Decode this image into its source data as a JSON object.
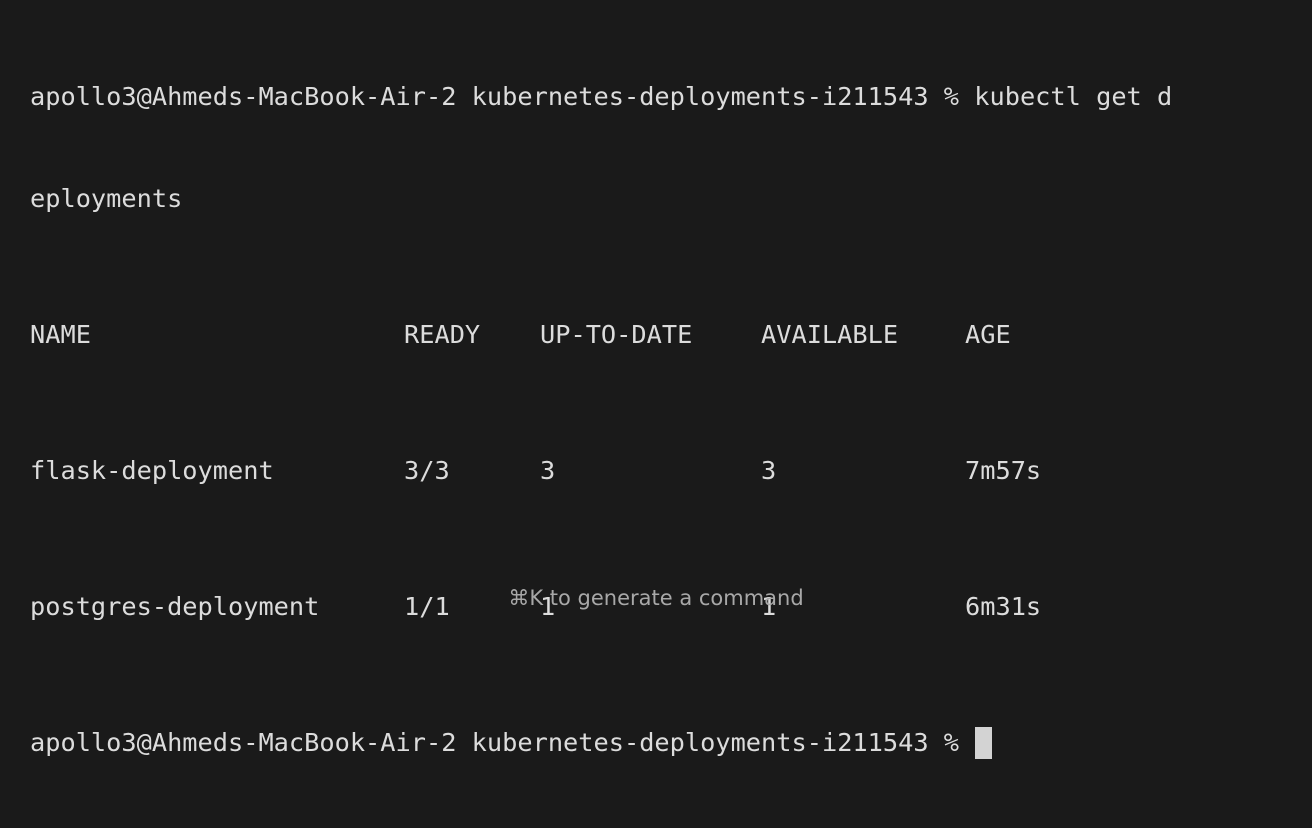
{
  "terminal": {
    "command_line_1": "apollo3@Ahmeds-MacBook-Air-2 kubernetes-deployments-i211543 % kubectl get d",
    "command_line_2": "eployments",
    "table": {
      "headers": [
        "NAME",
        "READY",
        "UP-TO-DATE",
        "AVAILABLE",
        "AGE"
      ],
      "rows": [
        [
          "flask-deployment",
          "3/3",
          "3",
          "3",
          "7m57s"
        ],
        [
          "postgres-deployment",
          "1/1",
          "1",
          "1",
          "6m31s"
        ]
      ]
    },
    "prompt": "apollo3@Ahmeds-MacBook-Air-2 kubernetes-deployments-i211543 %"
  },
  "hint": {
    "text": "⌘K to generate a command"
  },
  "colors": {
    "background": "#1a1a1a",
    "text": "#dcdcdc",
    "cursor": "#d3d3d3",
    "hint": "#a8a8a8"
  }
}
